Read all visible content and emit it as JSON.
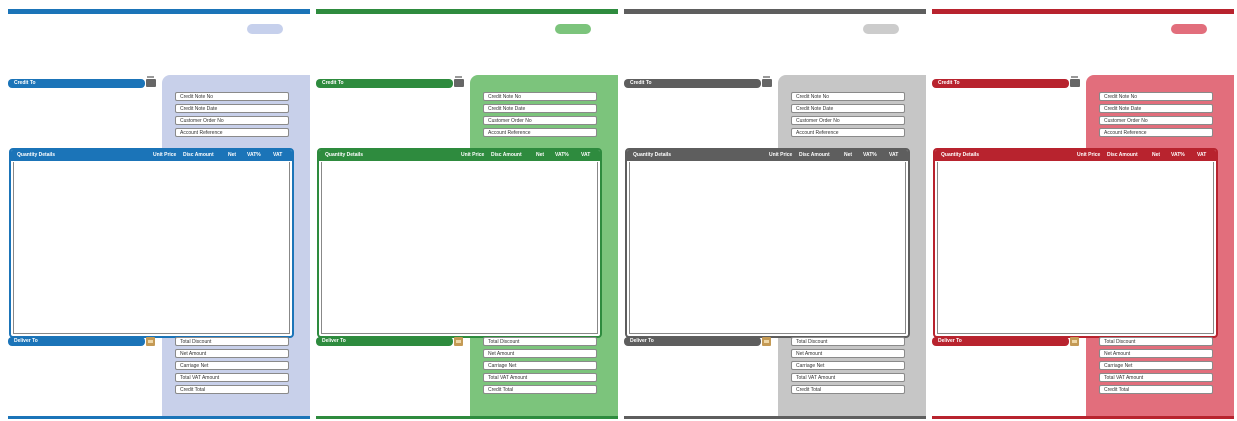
{
  "templates": [
    {
      "theme": "blue",
      "accent": "#1b74b8",
      "side_fill": "#c8d0ea",
      "pill_fill": "#c6d0ec"
    },
    {
      "theme": "green",
      "accent": "#2e8b3e",
      "side_fill": "#7cc47c",
      "pill_fill": "#7cc47c"
    },
    {
      "theme": "grey",
      "accent": "#5e5e5e",
      "side_fill": "#c6c6c6",
      "pill_fill": "#cccccc"
    },
    {
      "theme": "red",
      "accent": "#b8232e",
      "side_fill": "#e26e7c",
      "pill_fill": "#e26e7c"
    }
  ],
  "labels": {
    "credit_to": "Credit To",
    "deliver_to": "Deliver To",
    "credit_note_no": "Credit Note No",
    "credit_note_date": "Credit Note Date",
    "customer_order_no": "Customer Order No",
    "account_reference": "Account Reference",
    "quantity_details": "Quantity Details",
    "unit_price": "Unit Price",
    "disc_amount": "Disc Amount",
    "net": "Net",
    "vat_pct": "VAT%",
    "vat": "VAT",
    "total_discount": "Total Discount",
    "net_amount": "Net Amount",
    "carriage_net": "Carriage Net",
    "total_vat_amount": "Total VAT Amount",
    "credit_total": "Credit Total"
  }
}
